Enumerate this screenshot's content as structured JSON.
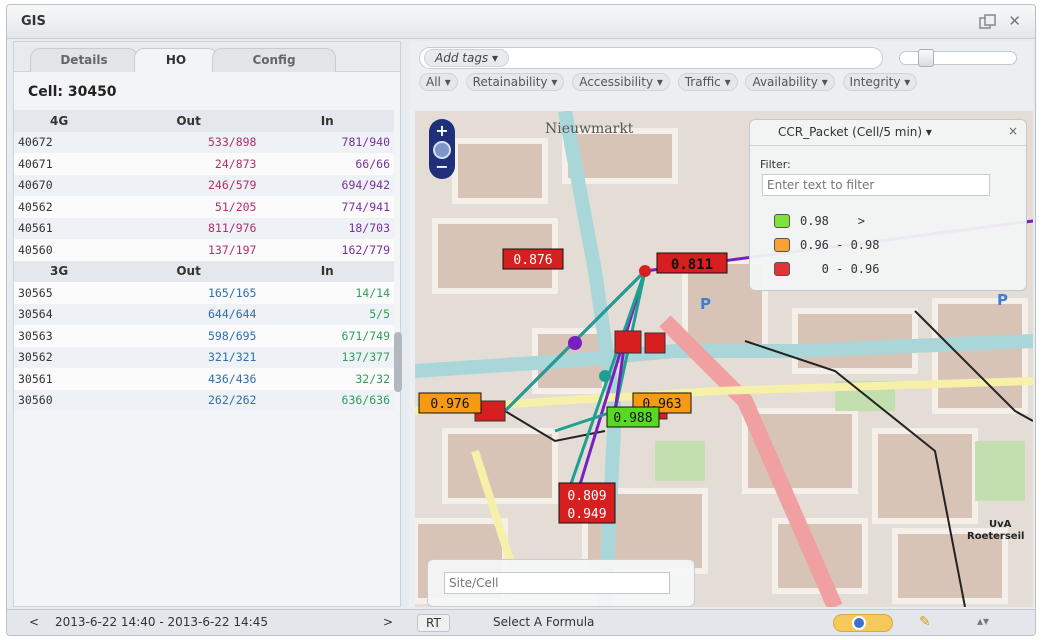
{
  "window": {
    "title": "GIS"
  },
  "left_panel": {
    "tabs": [
      {
        "label": "Details",
        "active": false
      },
      {
        "label": "HO",
        "active": true
      },
      {
        "label": "Config",
        "active": false
      }
    ],
    "cell_label": "Cell: 30450",
    "section_4g": {
      "headers": [
        "4G",
        "Out",
        "In"
      ],
      "rows": [
        {
          "id": "40672",
          "out": "533/898",
          "in": "781/940"
        },
        {
          "id": "40671",
          "out": "24/873",
          "in": "66/66"
        },
        {
          "id": "40670",
          "out": "246/579",
          "in": "694/942"
        },
        {
          "id": "40562",
          "out": "51/205",
          "in": "774/941"
        },
        {
          "id": "40561",
          "out": "811/976",
          "in": "18/703"
        },
        {
          "id": "40560",
          "out": "137/197",
          "in": "162/779"
        }
      ]
    },
    "section_3g": {
      "headers": [
        "3G",
        "Out",
        "In"
      ],
      "rows": [
        {
          "id": "30565",
          "out": "165/165",
          "in": "14/14"
        },
        {
          "id": "30564",
          "out": "644/644",
          "in": "5/5"
        },
        {
          "id": "30563",
          "out": "598/695",
          "in": "671/749"
        },
        {
          "id": "30562",
          "out": "321/321",
          "in": "137/377"
        },
        {
          "id": "30561",
          "out": "436/436",
          "in": "32/32"
        },
        {
          "id": "30560",
          "out": "262/262",
          "in": "636/636"
        }
      ]
    }
  },
  "toolbar": {
    "add_tags": "Add tags",
    "filters": [
      "All",
      "Retainability",
      "Accessibility",
      "Traffic",
      "Availability",
      "Integrity"
    ]
  },
  "map": {
    "zoom_in": "+",
    "zoom_out": "−",
    "street_label": "Nieuwmarkt",
    "markers": [
      {
        "label": "0.876",
        "color": "#d62020"
      },
      {
        "label": "0.811",
        "color": "#d62020"
      },
      {
        "label": "0.976",
        "color": "#f59a12"
      },
      {
        "label": "0.963",
        "color": "#f59a12"
      },
      {
        "label": "0.988",
        "color": "#58d81e"
      },
      {
        "label": "0.809",
        "color": "#d62020"
      },
      {
        "label": "0.949",
        "color": "#d62020"
      }
    ],
    "search_placeholder": "Site/Cell",
    "corner_labels": [
      "UvA",
      "Roeterseil"
    ]
  },
  "legend": {
    "title": "CCR_Packet (Cell/5 min)",
    "close": "×",
    "filter_label": "Filter:",
    "filter_placeholder": "Enter text to filter",
    "items": [
      {
        "color": "#7ee23a",
        "text": "0.98    >"
      },
      {
        "color": "#f7a233",
        "text": "0.96 - 0.98"
      },
      {
        "color": "#e23434",
        "text": "   0 - 0.96"
      }
    ]
  },
  "bottom_bar": {
    "prev": "<",
    "range": "2013-6-22 14:40 - 2013-6-22 14:45",
    "next": ">",
    "rt": "RT",
    "formula": "Select A Formula"
  }
}
